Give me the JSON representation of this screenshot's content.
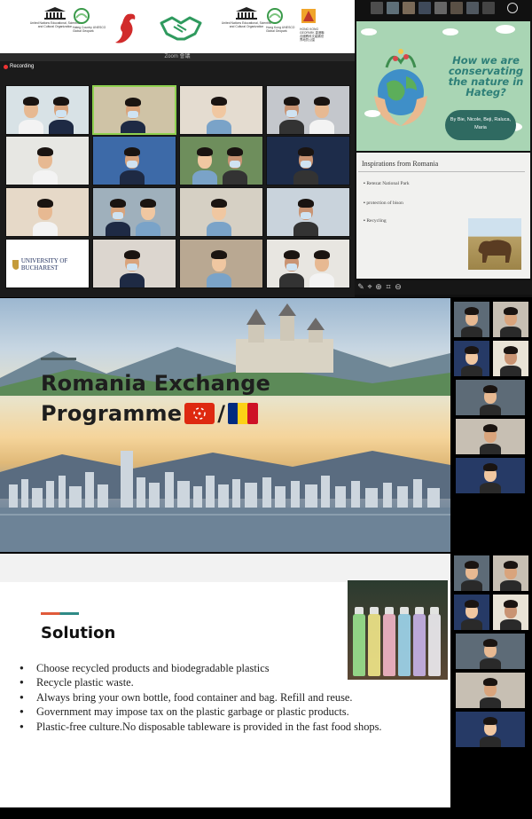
{
  "logo_bar": {
    "unesco_left": "United Nations Educational, Scientific and Cultural Organization",
    "geopark_left": "Hateg Country UNESCO Global Geopark",
    "unesco_right": "United Nations Educational, Scientific and Cultural Organization",
    "geopark_right": "Hong Kong UNESCO Global Geopark",
    "hk_geopark": "HONG KONG GEOPARK 香港聯合國教科文組織世界地質公園"
  },
  "zoom": {
    "window_title": "Zoom 會議",
    "recording_label": "Recording",
    "university_logo_text": "UNIVERSITY OF BUCHAREST"
  },
  "slide1": {
    "title": "How we are conservating the nature in Hateg?",
    "authors": "By Bie, Nicole, Beji, Raluca, Maria",
    "inspirations_title": "Inspirations from Romania",
    "bullets": [
      "Retezat National Park",
      "protection of bison",
      "Recycling"
    ]
  },
  "slide2": {
    "title_line1": "Romania Exchange",
    "title_line2": "Programme",
    "separator": "/"
  },
  "slide3": {
    "title": "Solution",
    "bullets": [
      "Choose recycled products and biodegradable plastics",
      "Recycle  plastic waste.",
      "Always bring your own bottle, food container and bag. Refill and reuse.",
      "Government may impose tax on the plastic garbage or plastic products.",
      "Plastic-free culture.No disposable tableware is provided in the fast food shops."
    ]
  },
  "colors": {
    "slide1_green": "#a9d5b4",
    "slide1_title": "#2e7f78",
    "solution_accent_red": "#e05a3a",
    "solution_accent_teal": "#2f8a86",
    "active_speaker": "#8fd14f"
  },
  "icons": [
    "unesco-temple-icon",
    "geopark-swirl-icon",
    "hateg-dinosaur-icon",
    "handshake-icon",
    "hk-geopark-icon",
    "hk-flag-icon",
    "romania-flag-icon",
    "pen-icon",
    "pointer-icon",
    "zoom-in-icon",
    "crop-icon",
    "stop-icon"
  ]
}
